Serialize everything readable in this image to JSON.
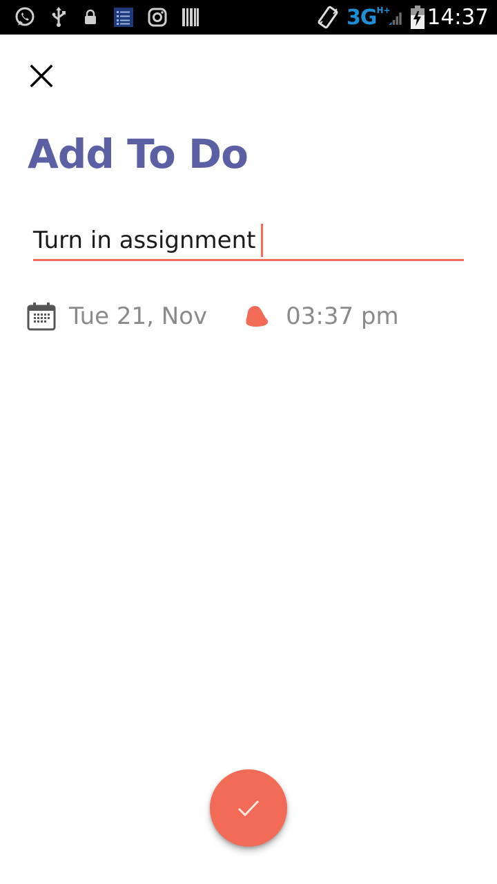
{
  "status_bar": {
    "network_label": "3G",
    "network_sub": "H+",
    "time": "14:37",
    "icons": [
      "whatsapp-icon",
      "usb-icon",
      "lock-icon",
      "tasks-app-icon",
      "instagram-icon",
      "barcode-icon",
      "vibrate-icon",
      "signal-icon",
      "battery-icon"
    ],
    "network_color": "#1e8ed6"
  },
  "header": {
    "close_icon": "close-icon",
    "title": "Add To Do"
  },
  "form": {
    "task_value": "Turn in assignment",
    "date_icon": "calendar-icon",
    "date_value": "Tue 21, Nov",
    "time_icon": "alarm-bell-icon",
    "time_value": "03:37 pm"
  },
  "fab": {
    "icon": "check-icon"
  },
  "colors": {
    "accent": "#f26b56",
    "title": "#5b5fa3",
    "muted_text": "#8a8a8a"
  }
}
